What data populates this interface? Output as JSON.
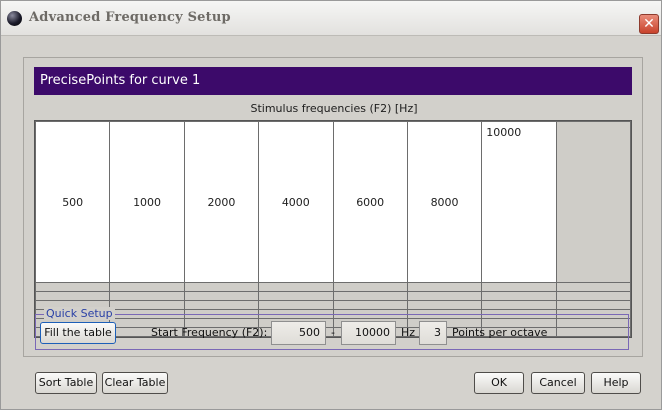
{
  "window": {
    "title": "Advanced Frequency Setup",
    "close_glyph": "✕"
  },
  "panel": {
    "header": "PrecisePoints for curve 1",
    "subtitle": "Stimulus frequencies (F2) [Hz]"
  },
  "table": {
    "columns": 8,
    "first_row": [
      "500",
      "1000",
      "2000",
      "4000",
      "6000",
      "8000",
      "10000",
      ""
    ]
  },
  "quick_setup": {
    "legend": "Quick Setup",
    "fill_button": "Fill the table",
    "start_label": "Start Frequency (F2):",
    "start_value": "500",
    "dash": "-",
    "end_value": "10000",
    "unit": "Hz",
    "points_value": "3",
    "points_label": "Points per octave"
  },
  "footer": {
    "sort": "Sort Table",
    "clear": "Clear Table",
    "ok": "OK",
    "cancel": "Cancel",
    "help": "Help"
  },
  "colors": {
    "header_bg": "#3c0a6a",
    "legend_text": "#2a41a6"
  }
}
